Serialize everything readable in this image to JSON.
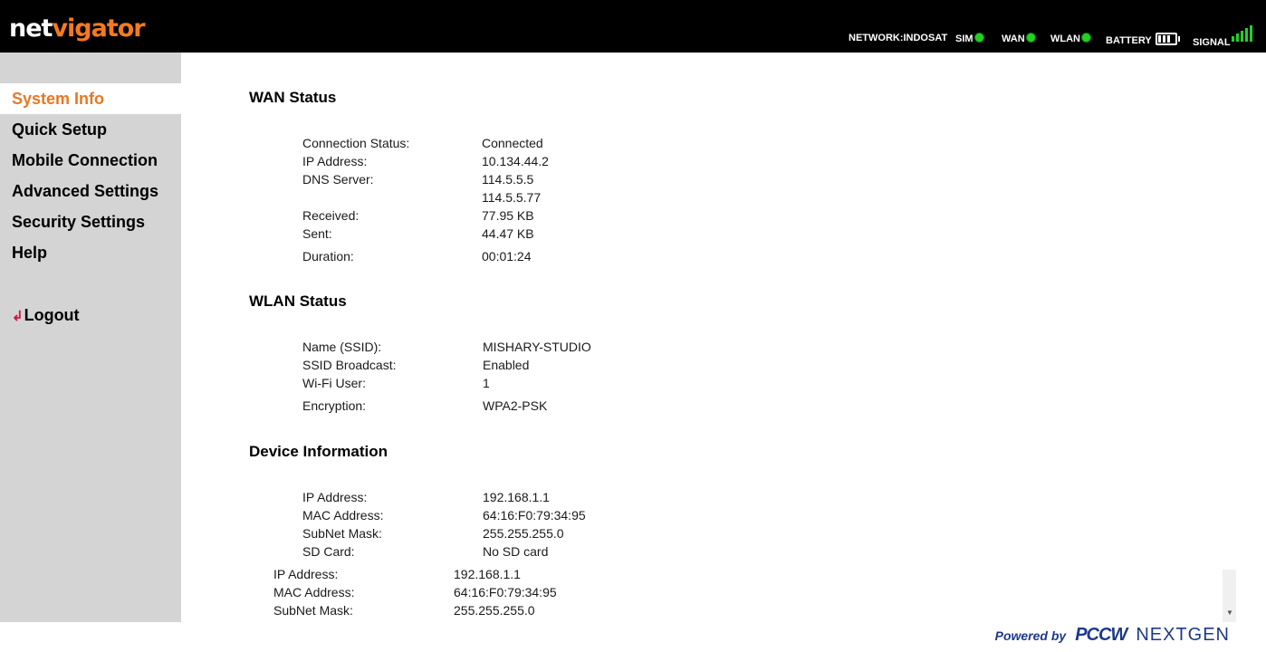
{
  "header": {
    "logo_part1": "net",
    "logo_part2": "vigator",
    "network": "NETWORK:INDOSAT",
    "sim": "SIM",
    "wan": "WAN",
    "wlan": "WLAN",
    "battery": "BATTERY",
    "signal": "SIGNAL"
  },
  "sidebar": {
    "items": [
      {
        "label": "System Info"
      },
      {
        "label": "Quick Setup"
      },
      {
        "label": "Mobile Connection"
      },
      {
        "label": "Advanced Settings"
      },
      {
        "label": "Security Settings"
      },
      {
        "label": "Help"
      }
    ],
    "logout": "Logout"
  },
  "wan": {
    "title": "WAN Status",
    "connection_label": "Connection Status:",
    "connection_value": "Connected",
    "ip_label": "IP Address:",
    "ip_value": "10.134.44.2",
    "dns_label": "DNS Server:",
    "dns_value_1": "114.5.5.5",
    "dns_value_2": "114.5.5.77",
    "received_label": "Received:",
    "received_value": "77.95 KB",
    "sent_label": "Sent:",
    "sent_value": "44.47 KB",
    "duration_label": "Duration:",
    "duration_value": "00:01:24"
  },
  "wlan": {
    "title": "WLAN Status",
    "name_label": "Name (SSID):",
    "name_value": "MISHARY-STUDIO",
    "broadcast_label": "SSID Broadcast:",
    "broadcast_value": "Enabled",
    "users_label": "Wi-Fi User:",
    "users_value": "1",
    "encryption_label": "Encryption:",
    "encryption_value": "WPA2-PSK"
  },
  "device": {
    "title": "Device Information",
    "ip_label": "IP Address:",
    "ip_value": "192.168.1.1",
    "mac_label": "MAC Address:",
    "mac_value": "64:16:F0:79:34:95",
    "subnet_label": "SubNet Mask:",
    "subnet_value": "255.255.255.0",
    "sd_label": "SD Card:",
    "sd_value": "No SD card"
  },
  "device_dup": {
    "ip_label": "IP Address:",
    "ip_value": "192.168.1.1",
    "mac_label": "MAC Address:",
    "mac_value": "64:16:F0:79:34:95",
    "subnet_label": "SubNet Mask:",
    "subnet_value": "255.255.255.0"
  },
  "footer": {
    "powered_by": "Powered by",
    "brand1": "PCCW",
    "brand2": "NEXTGEN"
  }
}
